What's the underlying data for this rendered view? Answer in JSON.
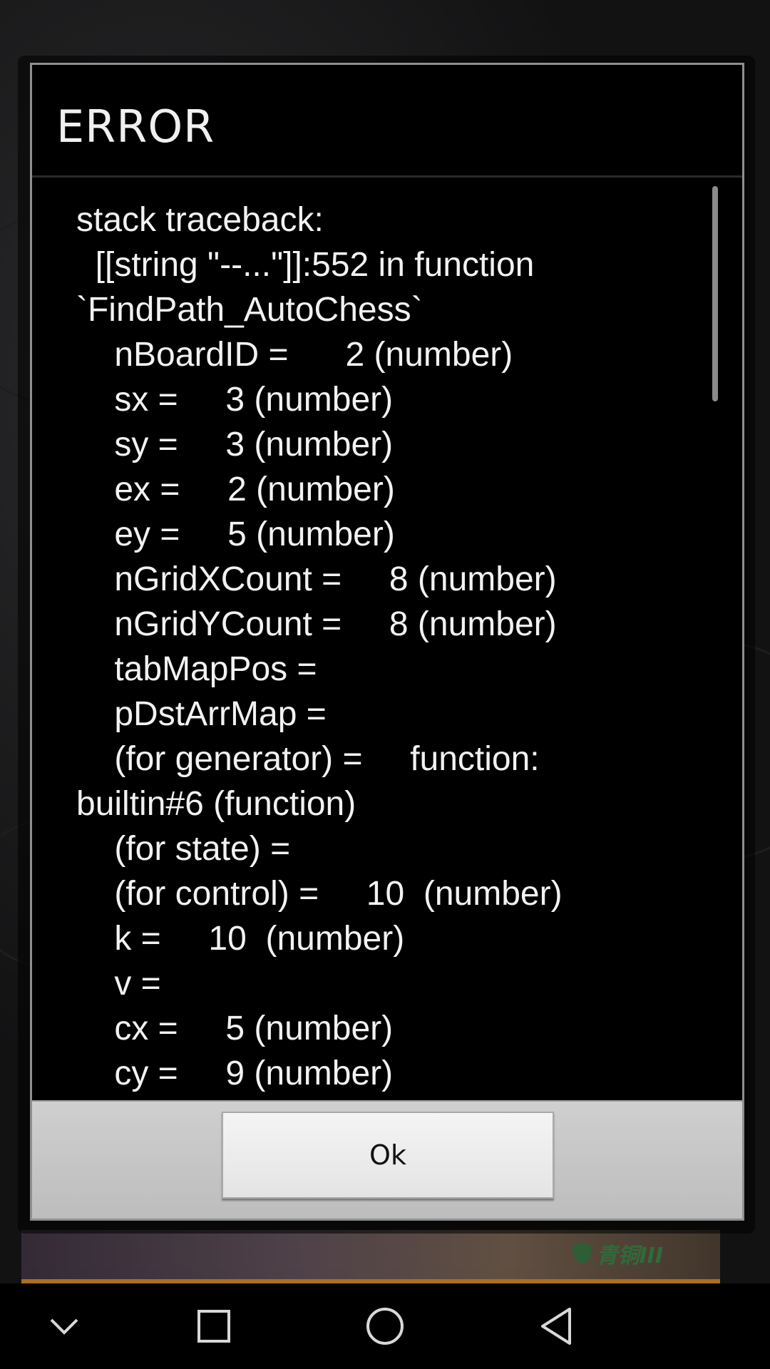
{
  "dialog": {
    "title": "ERROR",
    "trace_lines": [
      "stack traceback:",
      "  [[string \"--...\"]]:552 in function",
      "`FindPath_AutoChess`",
      "    nBoardID =      2 (number)",
      "    sx =     3 (number)",
      "    sy =     3 (number)",
      "    ex =     2 (number)",
      "    ey =     5 (number)",
      "    nGridXCount =     8 (number)",
      "    nGridYCount =     8 (number)",
      "    tabMapPos =",
      "    pDstArrMap =",
      "    (for generator) =     function:",
      "builtin#6 (function)",
      "    (for state) =",
      "    (for control) =     10  (number)",
      "    k =     10  (number)",
      "    v =",
      "    cx =     5 (number)",
      "    cy =     9 (number)"
    ],
    "ok_label": "Ok"
  },
  "background": {
    "rank_badge": "青铜III"
  },
  "navbar": {
    "icons": [
      "chevron-down-icon",
      "square-recents-icon",
      "circle-home-icon",
      "triangle-back-icon"
    ]
  },
  "colors": {
    "dialog_bg": "#000000",
    "button_bar": "#c8c8c8",
    "text": "#f2f2f2"
  }
}
